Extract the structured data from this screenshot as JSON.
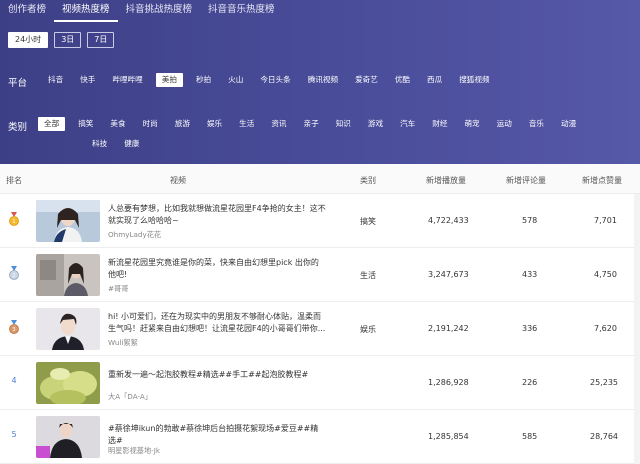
{
  "tabs": [
    "创作者榜",
    "视频热度榜",
    "抖音挑战热度榜",
    "抖音音乐热度榜"
  ],
  "active_tab": 1,
  "periods": [
    "24小时",
    "3日",
    "7日"
  ],
  "active_period": 0,
  "platform_label": "平台",
  "platforms": [
    "抖音",
    "快手",
    "哔哩哔哩",
    "美拍",
    "秒拍",
    "火山",
    "今日头条",
    "腾讯视频",
    "爱奇艺",
    "优酷",
    "西瓜",
    "搜狐视频"
  ],
  "active_platform": 3,
  "category_label": "类别",
  "categories": [
    "全部",
    "搞笑",
    "美食",
    "时尚",
    "旅游",
    "娱乐",
    "生活",
    "资讯",
    "亲子",
    "知识",
    "游戏",
    "汽车",
    "财经",
    "萌宠",
    "运动",
    "音乐",
    "动漫",
    "科技",
    "健康"
  ],
  "active_category": 0,
  "table": {
    "headers": {
      "rank": "排名",
      "video": "视频",
      "category": "类别",
      "plays": "新增播放量",
      "comments": "新增评论量",
      "likes": "新增点赞量"
    },
    "rows": [
      {
        "rank": "1",
        "title": "人总要有梦想，比如我就想做流星花园里F4争抢的女主！这不就实现了么哈哈哈~",
        "author": "OhmyLady花花",
        "category": "搞笑",
        "plays": "4,722,433",
        "comments": "578",
        "likes": "7,701"
      },
      {
        "rank": "2",
        "title": "新流星花园里究竟谁是你的菜，快来自由幻想里pick 出你的他吧!",
        "author": "#哥哥",
        "category": "生活",
        "plays": "3,247,673",
        "comments": "433",
        "likes": "4,750"
      },
      {
        "rank": "3",
        "title": "hi! 小可爱们，还在为现实中的男朋友不够耐心体贴，温柔而生气吗！赶紧来自由幻想吧！让流星花园F4的小哥哥们带你...",
        "author": "Wuli絮絮",
        "category": "娱乐",
        "plays": "2,191,242",
        "comments": "336",
        "likes": "7,620"
      },
      {
        "rank": "4",
        "title": "重新发一遍～起泡胶教程#精选##手工##起泡胶教程#",
        "author": "大A「DA-A」",
        "category": "",
        "plays": "1,286,928",
        "comments": "226",
        "likes": "25,235"
      },
      {
        "rank": "5",
        "title": "#蔡徐坤ikun的勃敢#蔡徐坤后台拍摄花絮现场#爱豆##精选#",
        "author": "明星影视基地-Jk",
        "category": "",
        "plays": "1,285,854",
        "comments": "585",
        "likes": "28,764"
      }
    ]
  },
  "colors": {
    "header_bg": "#4a4d9a",
    "rank_blue": "#4a7fd0"
  }
}
